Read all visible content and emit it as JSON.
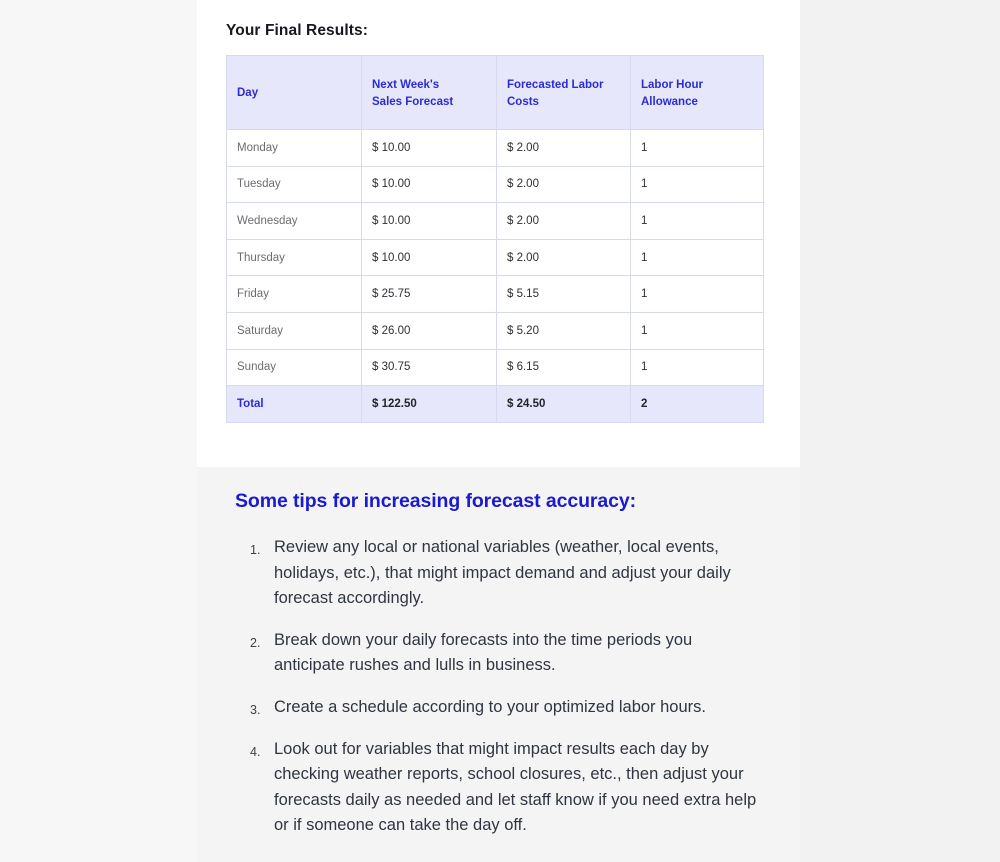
{
  "card": {
    "results_title": "Your Final Results:"
  },
  "table": {
    "headers": [
      "Day",
      "Next Week's Sales Forecast",
      "Forecasted Labor Costs",
      "Labor Hour Allowance"
    ],
    "rows": [
      {
        "day": "Monday",
        "forecast": "$ 10.00",
        "cost": "$ 2.00",
        "hours": "1"
      },
      {
        "day": "Tuesday",
        "forecast": "$ 10.00",
        "cost": "$ 2.00",
        "hours": "1"
      },
      {
        "day": "Wednesday",
        "forecast": "$ 10.00",
        "cost": "$ 2.00",
        "hours": "1"
      },
      {
        "day": "Thursday",
        "forecast": "$ 10.00",
        "cost": "$ 2.00",
        "hours": "1"
      },
      {
        "day": "Friday",
        "forecast": "$ 25.75",
        "cost": "$ 5.15",
        "hours": "1"
      },
      {
        "day": "Saturday",
        "forecast": "$ 26.00",
        "cost": "$ 5.20",
        "hours": "1"
      },
      {
        "day": "Sunday",
        "forecast": "$ 30.75",
        "cost": "$ 6.15",
        "hours": "1"
      }
    ],
    "total": {
      "day": "Total",
      "forecast": "$ 122.50",
      "cost": "$ 24.50",
      "hours": "2"
    }
  },
  "tips": {
    "title": "Some tips for increasing forecast accuracy:",
    "items": [
      "Review any local or national variables (weather, local events, holidays, etc.), that might impact demand and adjust your daily forecast accordingly.",
      "Break down your daily forecasts into the time periods you anticipate rushes and lulls in business.",
      "Create a schedule according to your optimized labor hours.",
      "Look out for variables that might impact results each day by checking weather reports, school closures, etc., then adjust your forecasts daily as needed and let staff know if you need extra help or if someone can take the day off."
    ]
  },
  "colors": {
    "accent_blue": "#2b2bd4",
    "heading_blue": "#1a1ad0",
    "header_bg": "#e7e7fb",
    "page_bg": "#f4f4f5",
    "card_bg": "#ffffff",
    "border": "#d8d8ef"
  }
}
